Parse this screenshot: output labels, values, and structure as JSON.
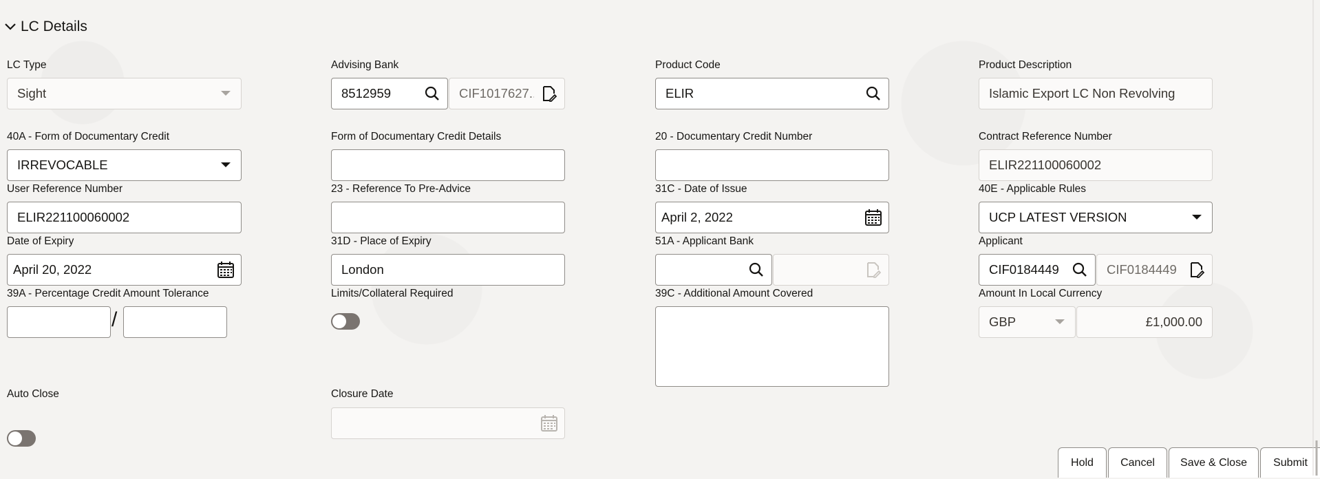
{
  "section": {
    "title": "LC Details"
  },
  "fields": {
    "lc_type": {
      "label": "LC Type",
      "value": "Sight"
    },
    "advising_bank": {
      "label": "Advising Bank",
      "value": "8512959",
      "name_value": "CIF1017627..."
    },
    "product_code": {
      "label": "Product Code",
      "value": "ELIR"
    },
    "product_description": {
      "label": "Product Description",
      "value": "Islamic Export LC Non Revolving"
    },
    "form_of_credit": {
      "label": "40A - Form of Documentary Credit",
      "value": "IRREVOCABLE"
    },
    "form_of_credit_details": {
      "label": "Form of Documentary Credit Details",
      "value": ""
    },
    "documentary_credit_number": {
      "label": "20 - Documentary Credit Number",
      "value": ""
    },
    "contract_reference_number": {
      "label": "Contract Reference Number",
      "value": "ELIR221100060002"
    },
    "user_reference_number": {
      "label": "User Reference Number",
      "value": "ELIR221100060002"
    },
    "reference_pre_advice": {
      "label": "23 - Reference To Pre-Advice",
      "value": ""
    },
    "date_of_issue": {
      "label": "31C - Date of Issue",
      "value": "April 2, 2022"
    },
    "applicable_rules": {
      "label": "40E - Applicable Rules",
      "value": "UCP LATEST VERSION"
    },
    "date_of_expiry": {
      "label": "Date of Expiry",
      "value": "April 20, 2022"
    },
    "place_of_expiry": {
      "label": "31D - Place of Expiry",
      "value": "London"
    },
    "applicant_bank": {
      "label": "51A - Applicant Bank",
      "value": "",
      "name_value": ""
    },
    "applicant": {
      "label": "Applicant",
      "value": "CIF0184449",
      "name_value": "CIF0184449"
    },
    "percentage_tolerance": {
      "label": "39A - Percentage Credit Amount Tolerance",
      "value_plus": "",
      "value_minus": "",
      "separator": "/"
    },
    "limits_required": {
      "label": "Limits/Collateral Required",
      "on": false
    },
    "additional_amount": {
      "label": "39C - Additional Amount Covered",
      "value": ""
    },
    "amount_local": {
      "label": "Amount In Local Currency",
      "currency": "GBP",
      "value": "£1,000.00"
    },
    "auto_close": {
      "label": "Auto Close",
      "on": false
    },
    "closure_date": {
      "label": "Closure Date",
      "value": ""
    }
  },
  "actions": {
    "hold": "Hold",
    "cancel": "Cancel",
    "save_close": "Save & Close",
    "submit": "Submit"
  },
  "icons": {
    "search": "search-icon",
    "calendar": "calendar-icon",
    "dropdown": "caret-down-icon",
    "edit_doc": "edit-document-icon",
    "chevron": "chevron-down-icon"
  }
}
